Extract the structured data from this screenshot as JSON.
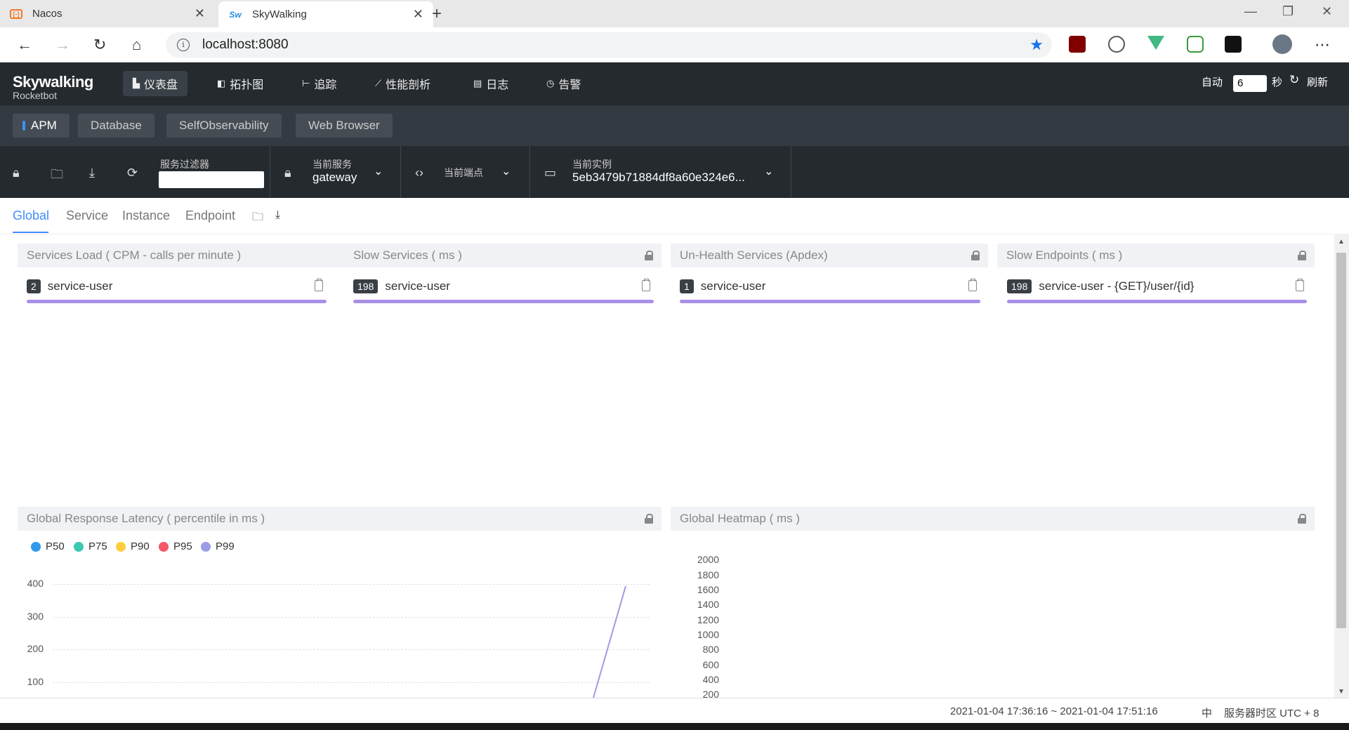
{
  "browser": {
    "tabs": [
      {
        "title": "Nacos",
        "icon": "nacos-icon"
      },
      {
        "title": "SkyWalking",
        "icon": "skywalking-icon"
      }
    ],
    "url": "localhost:8080"
  },
  "app": {
    "logo_line1": "Skywalking",
    "logo_line2": "Rocketbot",
    "nav": [
      {
        "label": "仪表盘",
        "icon": "dashboard-icon",
        "active": true
      },
      {
        "label": "拓扑图",
        "icon": "topology-icon"
      },
      {
        "label": "追踪",
        "icon": "trace-icon"
      },
      {
        "label": "性能剖析",
        "icon": "profile-icon"
      },
      {
        "label": "日志",
        "icon": "log-icon"
      },
      {
        "label": "告警",
        "icon": "alarm-icon"
      }
    ],
    "auto_label": "自动",
    "auto_seconds": "6",
    "seconds_label": "秒",
    "refresh_label": "刷新"
  },
  "dashboards": {
    "tabs": [
      "APM",
      "Database",
      "SelfObservability",
      "Web Browser"
    ],
    "active": "APM"
  },
  "selectors": {
    "filter_label": "服务过滤器",
    "filter_value": "",
    "service_label": "当前服务",
    "service_value": "gateway",
    "endpoint_label": "当前端点",
    "endpoint_value": "",
    "instance_label": "当前实例",
    "instance_value": "5eb3479b71884df8a60e324e6..."
  },
  "subtabs": {
    "items": [
      "Global",
      "Service",
      "Instance",
      "Endpoint"
    ],
    "active": "Global"
  },
  "panels": {
    "services_load": {
      "title": "Services Load ( CPM - calls per minute )",
      "items": [
        {
          "value": "2",
          "name": "service-user",
          "progress": 1.0
        }
      ]
    },
    "slow_services": {
      "title": "Slow Services ( ms )",
      "items": [
        {
          "value": "198",
          "name": "service-user",
          "progress": 1.0
        }
      ]
    },
    "unhealth_services": {
      "title": "Un-Health Services (Apdex)",
      "items": [
        {
          "value": "1",
          "name": "service-user",
          "progress": 1.0
        }
      ]
    },
    "slow_endpoints": {
      "title": "Slow Endpoints ( ms )",
      "items": [
        {
          "value": "198",
          "name": "service-user - {GET}/user/{id}",
          "progress": 1.0
        }
      ]
    },
    "latency": {
      "title": "Global Response Latency ( percentile in ms )"
    },
    "heatmap": {
      "title": "Global Heatmap ( ms )"
    }
  },
  "chart_data": [
    {
      "type": "line",
      "series": [
        {
          "name": "P50",
          "color": "#2f9bea"
        },
        {
          "name": "P75",
          "color": "#3cc8b4"
        },
        {
          "name": "P90",
          "color": "#fdce3d"
        },
        {
          "name": "P95",
          "color": "#f7566b"
        },
        {
          "name": "P99",
          "color": "#9c9ce6"
        }
      ],
      "yticks": [
        "400",
        "300",
        "200",
        "100"
      ],
      "ylim": [
        0,
        400
      ],
      "visible_segment": {
        "series": "P99",
        "from_y": 0,
        "to_y": 400
      }
    },
    {
      "type": "heatmap",
      "yticks": [
        "2000",
        "1800",
        "1600",
        "1400",
        "1200",
        "1000",
        "800",
        "600",
        "400",
        "200"
      ]
    }
  ],
  "footer": {
    "time_range": "2021-01-04 17:36:16 ~ 2021-01-04 17:51:16",
    "lang": "中",
    "timezone": "服务器时区 UTC + 8"
  }
}
